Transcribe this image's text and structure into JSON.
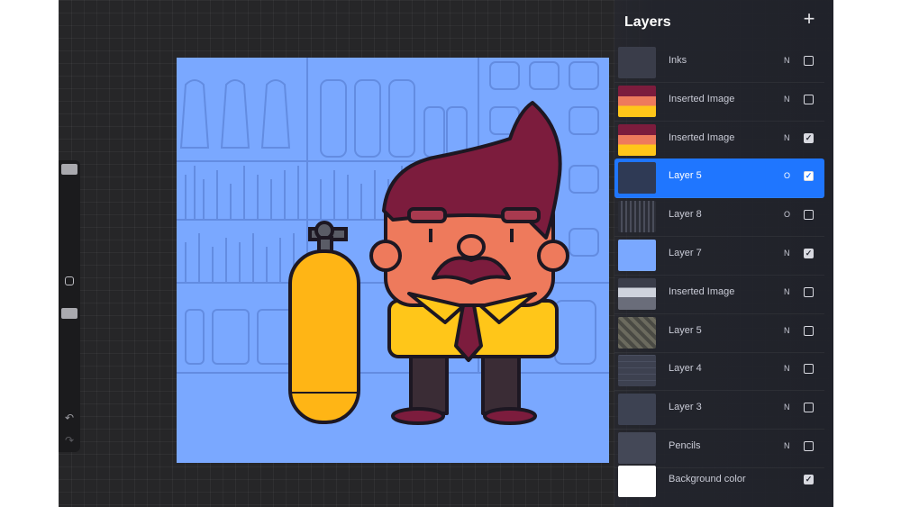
{
  "panel": {
    "title": "Layers",
    "add_icon": "plus-icon",
    "add_label": "+"
  },
  "layers": [
    {
      "name": "Inks",
      "blend": "N",
      "visible": false,
      "selected": false,
      "thumb": "inks"
    },
    {
      "name": "Inserted Image",
      "blend": "N",
      "visible": false,
      "selected": false,
      "thumb": "character"
    },
    {
      "name": "Inserted Image",
      "blend": "N",
      "visible": true,
      "selected": false,
      "thumb": "character"
    },
    {
      "name": "Layer 5",
      "blend": "O",
      "visible": true,
      "selected": true,
      "thumb": "dark"
    },
    {
      "name": "Layer 8",
      "blend": "O",
      "visible": false,
      "selected": false,
      "thumb": "texture"
    },
    {
      "name": "Layer 7",
      "blend": "N",
      "visible": true,
      "selected": false,
      "thumb": "blue"
    },
    {
      "name": "Inserted Image",
      "blend": "N",
      "visible": false,
      "selected": false,
      "thumb": "sketch"
    },
    {
      "name": "Layer 5",
      "blend": "N",
      "visible": false,
      "selected": false,
      "thumb": "pattern"
    },
    {
      "name": "Layer 4",
      "blend": "N",
      "visible": false,
      "selected": false,
      "thumb": "lines"
    },
    {
      "name": "Layer 3",
      "blend": "N",
      "visible": false,
      "selected": false,
      "thumb": "faint"
    },
    {
      "name": "Pencils",
      "blend": "N",
      "visible": false,
      "selected": false,
      "thumb": "pencil"
    }
  ],
  "background_layer": {
    "name": "Background color",
    "visible": true,
    "color": "#ffffff"
  },
  "checkmark": "✓",
  "toolbar": {
    "undo_icon": "undo-icon",
    "undo_glyph": "↶",
    "redo_icon": "redo-icon",
    "redo_glyph": "↷",
    "modify_icon": "square-modify-icon"
  },
  "colors": {
    "accent": "#1f76ff",
    "canvas_bg": "#7aa8ff",
    "tank": "#ffb515",
    "hair": "#7c1c3d",
    "skin": "#ee7a5c",
    "shirt": "#ffc619"
  }
}
